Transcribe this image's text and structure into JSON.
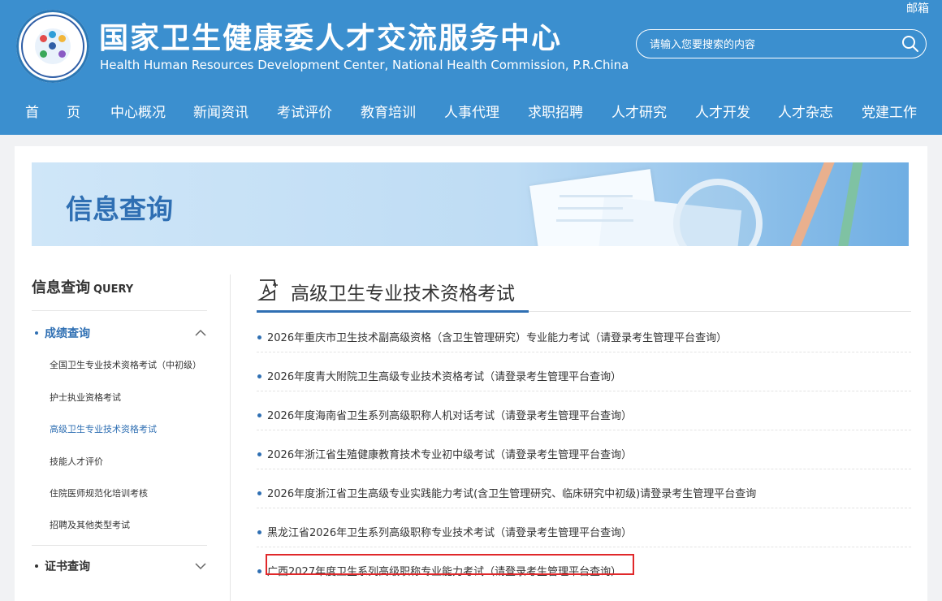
{
  "header": {
    "title": "国家卫生健康委人才交流服务中心",
    "subtitle": "Health Human Resources Development Center, National Health Commission, P.R.China",
    "mail_label": "邮箱",
    "search": {
      "placeholder": "请输入您要搜索的内容"
    },
    "brand_color": "#3b8fcf"
  },
  "nav": {
    "items": [
      {
        "label": "首　　页"
      },
      {
        "label": "中心概况"
      },
      {
        "label": "新闻资讯"
      },
      {
        "label": "考试评价"
      },
      {
        "label": "教育培训"
      },
      {
        "label": "人事代理"
      },
      {
        "label": "求职招聘"
      },
      {
        "label": "人才研究"
      },
      {
        "label": "人才开发"
      },
      {
        "label": "人才杂志"
      },
      {
        "label": "党建工作"
      }
    ]
  },
  "banner": {
    "title": "信息查询"
  },
  "sidebar": {
    "heading": "信息查询",
    "heading_en": "QUERY",
    "sections": [
      {
        "label": "成绩查询",
        "expanded": true,
        "color": "#2f6fb3",
        "items": [
          {
            "label": "全国卫生专业技术资格考试（中初级）",
            "active": false
          },
          {
            "label": "护士执业资格考试",
            "active": false
          },
          {
            "label": "高级卫生专业技术资格考试",
            "active": true
          },
          {
            "label": "技能人才评价",
            "active": false
          },
          {
            "label": "住院医师规范化培训考核",
            "active": false
          },
          {
            "label": "招聘及其他类型考试",
            "active": false
          }
        ]
      },
      {
        "label": "证书查询",
        "expanded": false,
        "color": "#333333"
      }
    ]
  },
  "main": {
    "title": "高级卫生专业技术资格考试",
    "items": [
      {
        "text": "2026年重庆市卫生技术副高级资格（含卫生管理研究）专业能力考试（请登录考生管理平台查询）"
      },
      {
        "text": "2026年度青大附院卫生高级专业技术资格考试（请登录考生管理平台查询）"
      },
      {
        "text": "2026年度海南省卫生系列高级职称人机对话考试（请登录考生管理平台查询）"
      },
      {
        "text": "2026年浙江省生殖健康教育技术专业初中级考试（请登录考生管理平台查询）"
      },
      {
        "text": "2026年度浙江省卫生高级专业实践能力考试(含卫生管理研究、临床研究中初级)请登录考生管理平台查询"
      },
      {
        "text": "黑龙江省2026年卫生系列高级职称专业技术考试（请登录考生管理平台查询）"
      },
      {
        "text": "广西2027年度卫生系列高级职称专业能力考试（请登录考生管理平台查询）",
        "highlighted": true
      }
    ]
  }
}
